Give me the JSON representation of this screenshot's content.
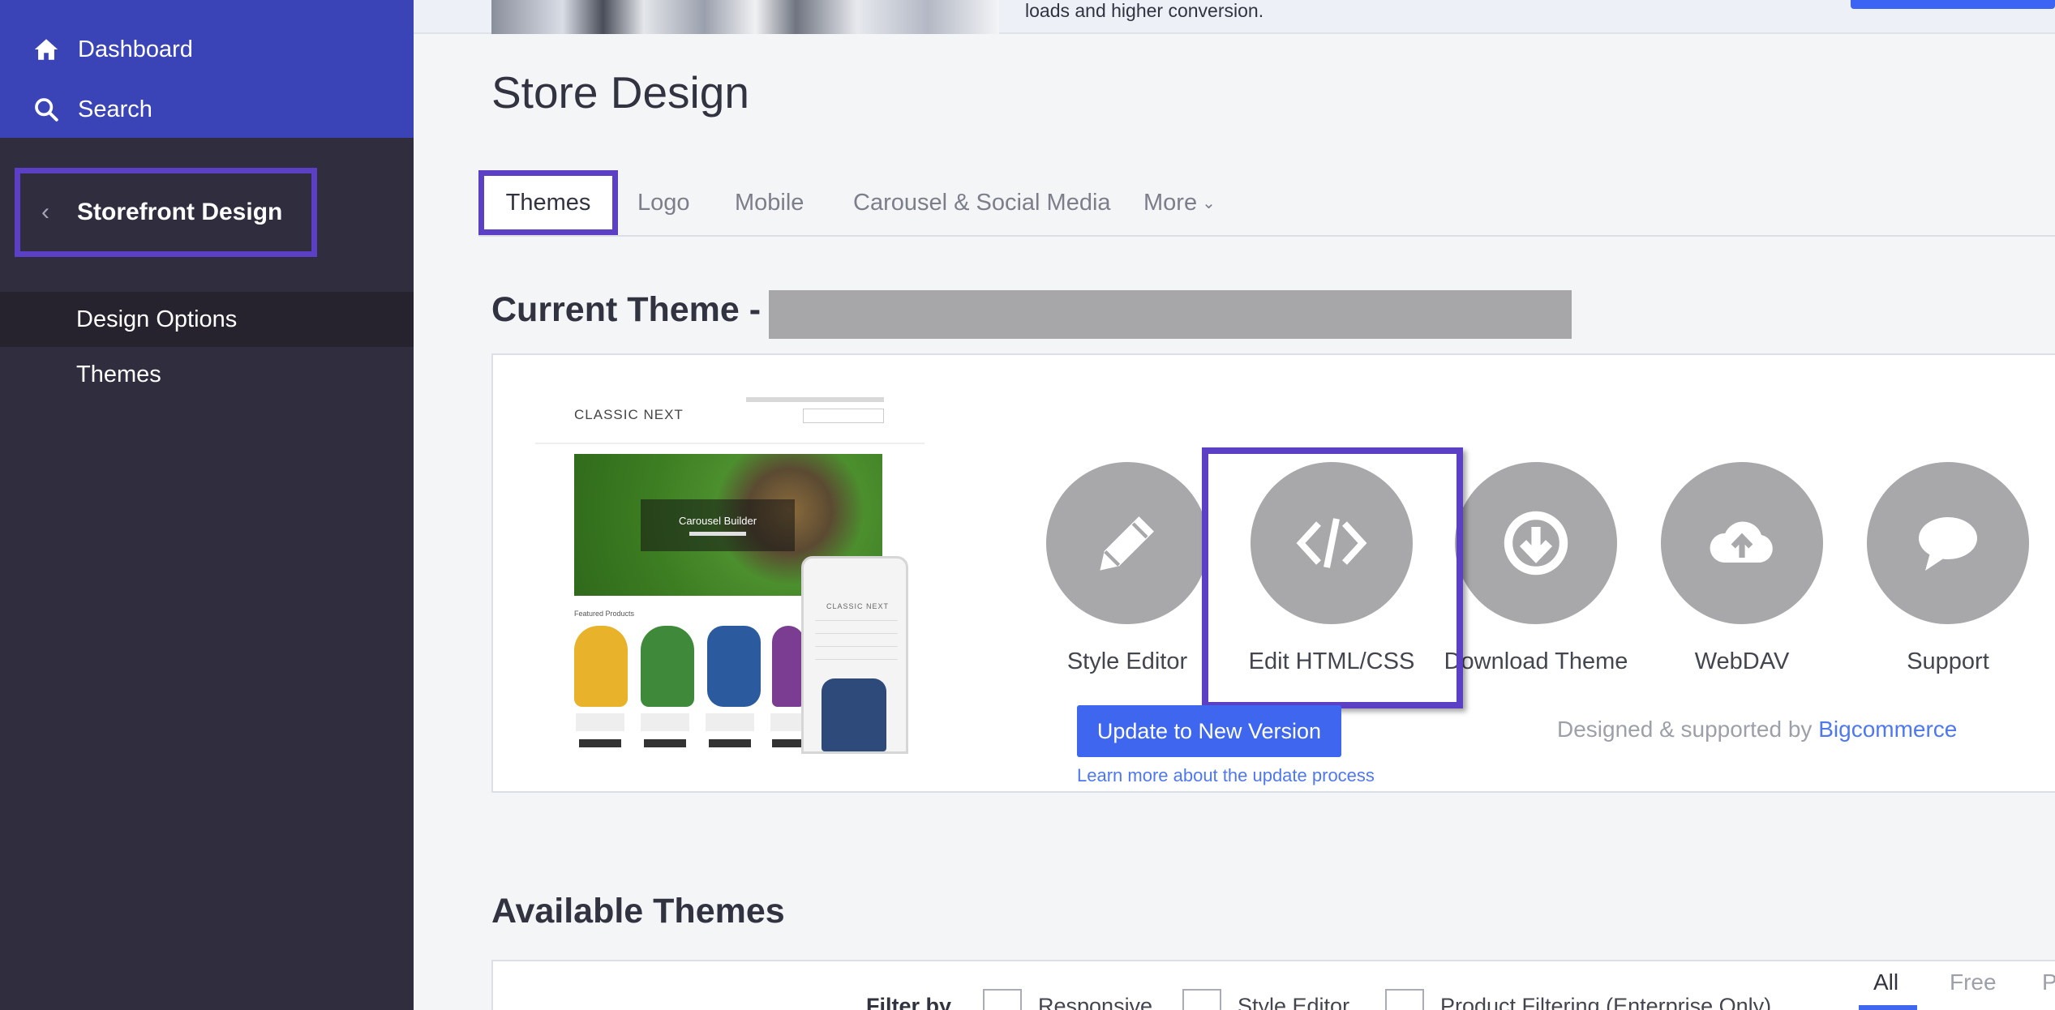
{
  "sidebar": {
    "dashboard_label": "Dashboard",
    "search_label": "Search",
    "section_title": "Storefront Design",
    "items": [
      {
        "label": "Design Options"
      },
      {
        "label": "Themes"
      }
    ]
  },
  "promo": {
    "text": "loads and higher conversion."
  },
  "page": {
    "title": "Store Design"
  },
  "tabs": [
    {
      "label": "Themes"
    },
    {
      "label": "Logo"
    },
    {
      "label": "Mobile"
    },
    {
      "label": "Carousel & Social Media"
    },
    {
      "label": "More"
    }
  ],
  "current_theme": {
    "heading": "Current Theme -",
    "preview": {
      "logo_text": "CLASSIC NEXT",
      "hero_caption": "Carousel Builder",
      "featured_label": "Featured Products",
      "phone_logo_text": "CLASSIC NEXT"
    },
    "actions": [
      {
        "label": "Style Editor",
        "icon": "pencil-icon"
      },
      {
        "label": "Edit HTML/CSS",
        "icon": "code-icon"
      },
      {
        "label": "Download Theme",
        "icon": "download-icon"
      },
      {
        "label": "WebDAV",
        "icon": "cloud-upload-icon"
      },
      {
        "label": "Support",
        "icon": "speech-bubble-icon"
      }
    ],
    "update_button": "Update to New Version",
    "learn_more": "Learn more about the update process",
    "designed_prefix": "Designed & supported by",
    "designed_link": "Bigcommerce"
  },
  "available_themes": {
    "heading": "Available Themes",
    "filter_by": "Filter by",
    "filters": [
      {
        "label": "Responsive"
      },
      {
        "label": "Style Editor"
      },
      {
        "label": "Product Filtering (Enterprise Only)"
      }
    ],
    "tabs": [
      {
        "label": "All"
      },
      {
        "label": "Free"
      },
      {
        "label": "P"
      }
    ]
  },
  "colors": {
    "sidebar_bg": "#302d3f",
    "sidebar_top_bg": "#3b44b7",
    "highlight_border": "#5b3fc4",
    "primary_button": "#3f66ee",
    "link": "#4f78f0",
    "icon_circle": "#a8a8ab"
  }
}
